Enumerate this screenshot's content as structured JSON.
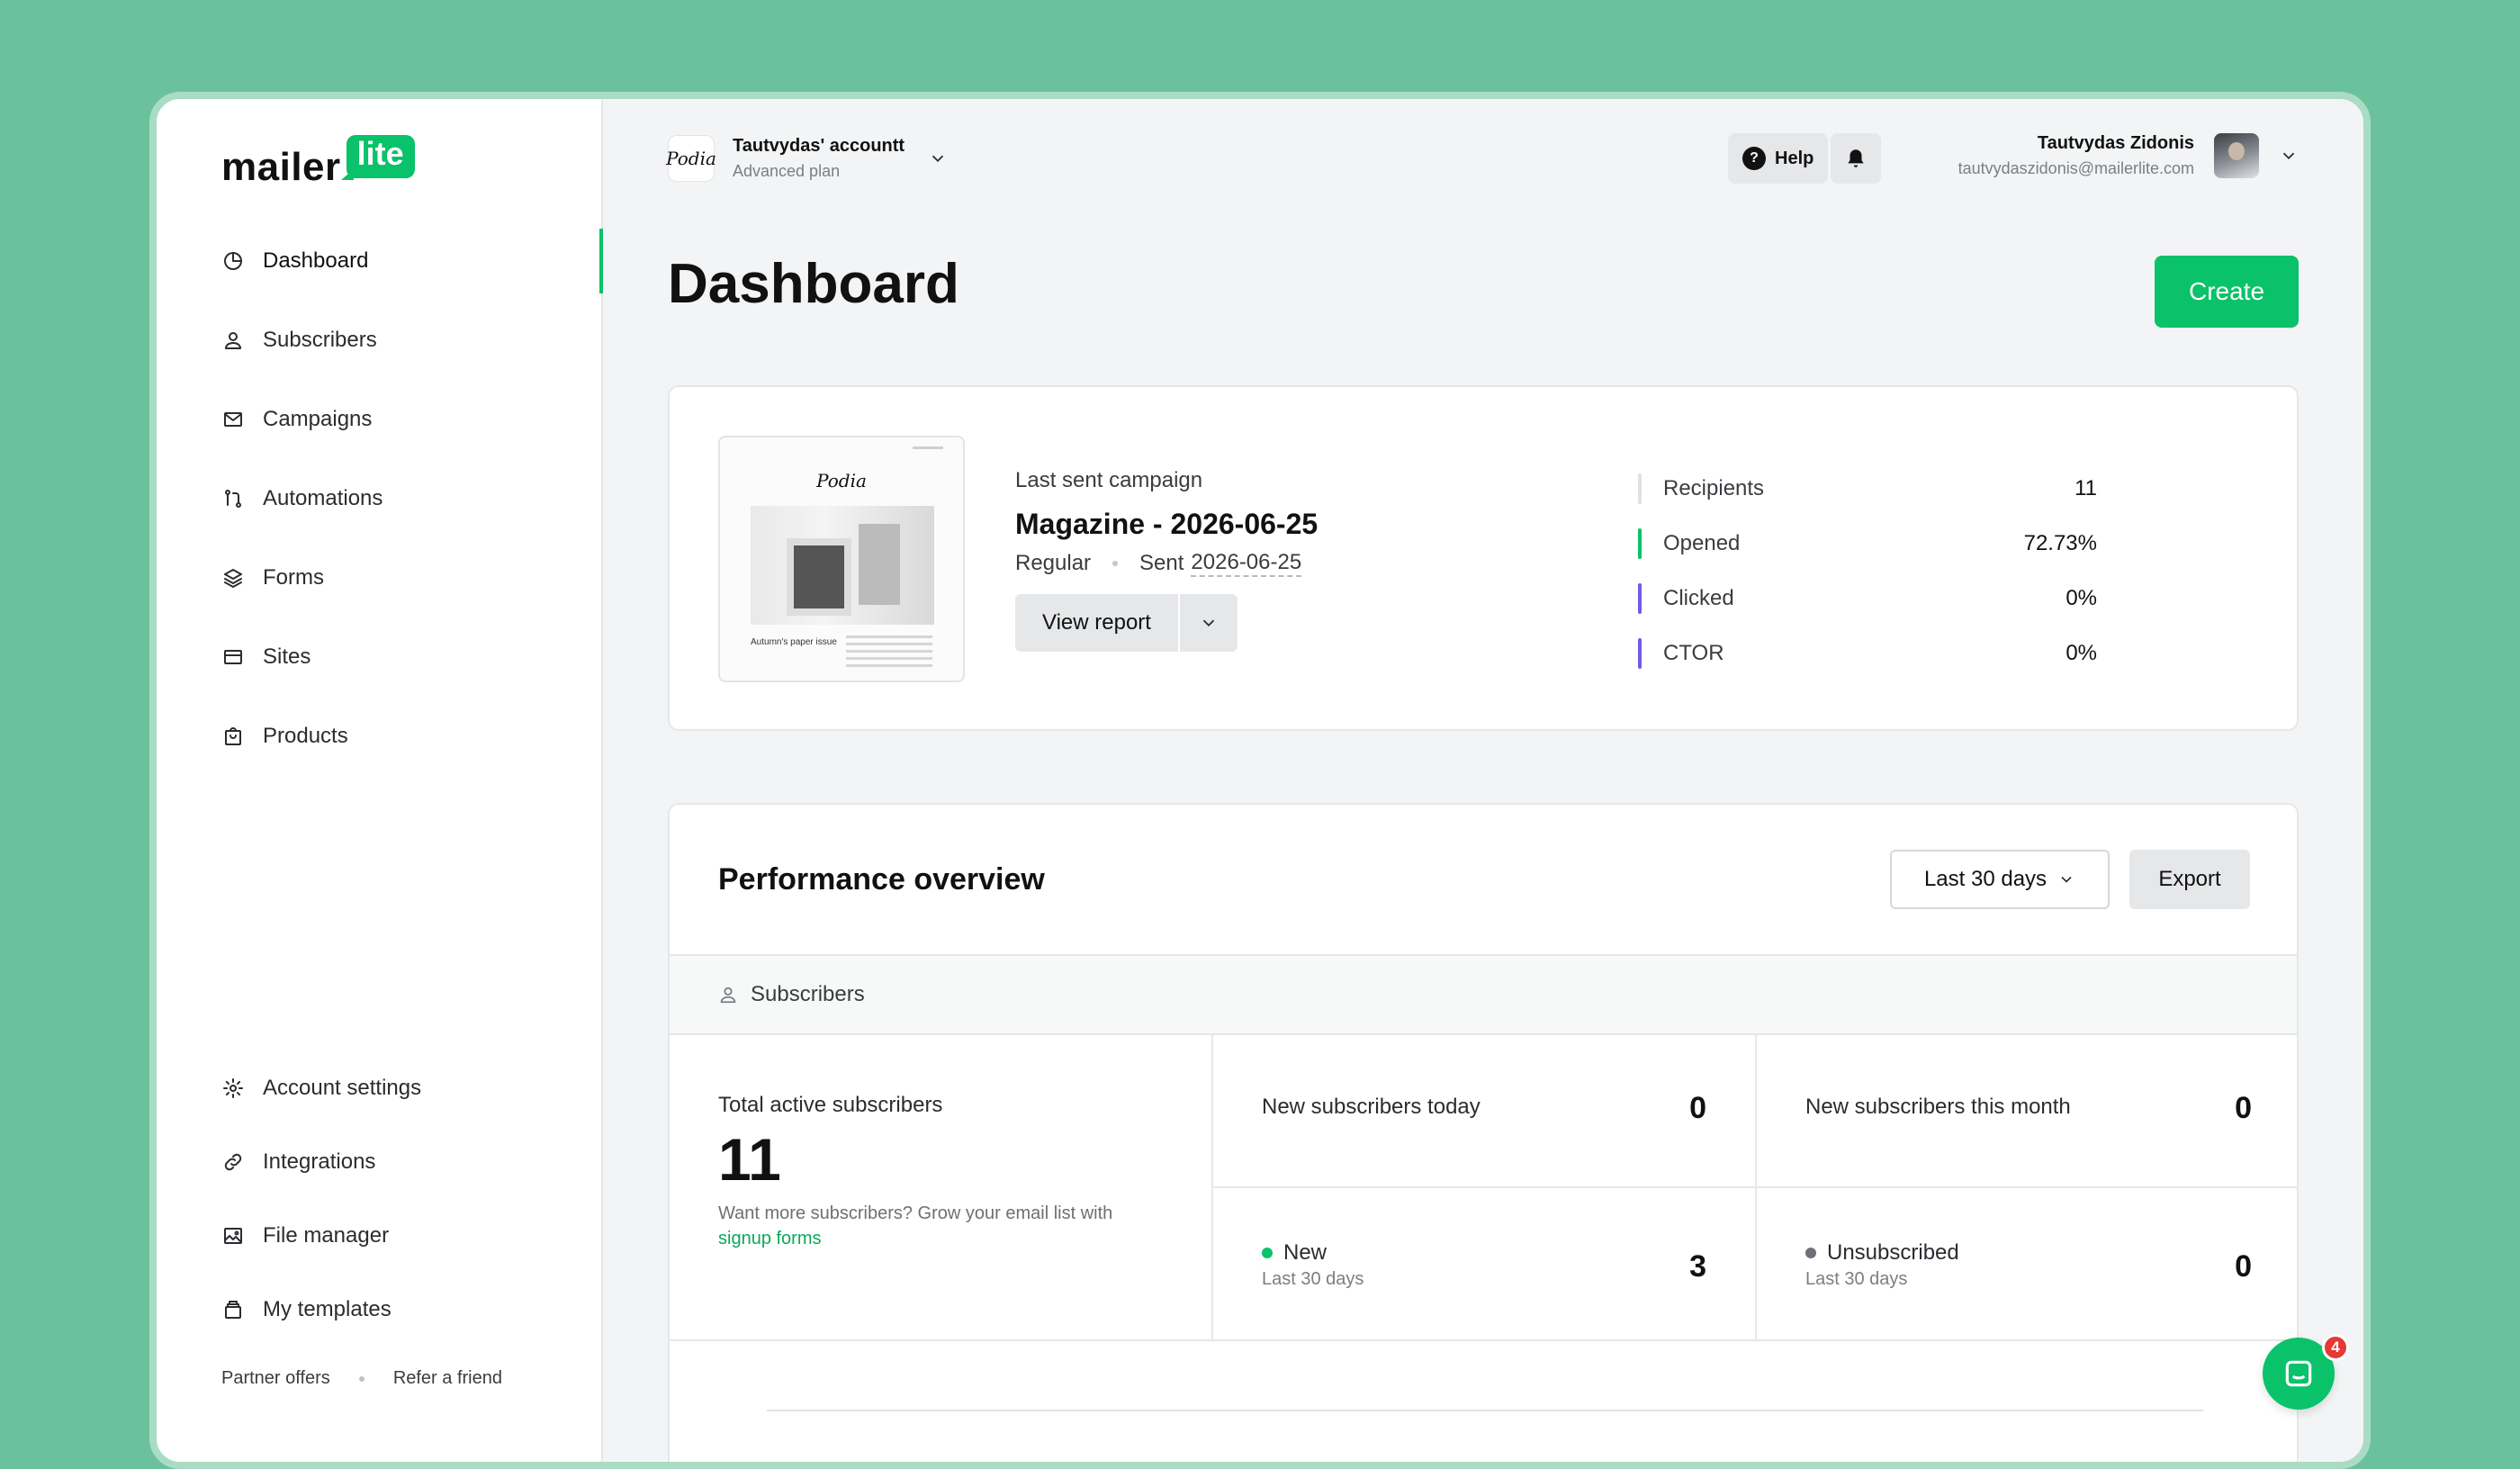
{
  "brand": {
    "word": "mailer",
    "badge": "lite",
    "accent": "#09c269"
  },
  "sidebar": {
    "items": [
      {
        "label": "Dashboard",
        "icon": "dashboard-icon",
        "active": true
      },
      {
        "label": "Subscribers",
        "icon": "user-icon"
      },
      {
        "label": "Campaigns",
        "icon": "mail-icon"
      },
      {
        "label": "Automations",
        "icon": "automation-icon"
      },
      {
        "label": "Forms",
        "icon": "layers-icon"
      },
      {
        "label": "Sites",
        "icon": "browser-icon"
      },
      {
        "label": "Products",
        "icon": "bag-icon"
      }
    ],
    "bottom_items": [
      {
        "label": "Account settings",
        "icon": "gear-icon"
      },
      {
        "label": "Integrations",
        "icon": "link-icon"
      },
      {
        "label": "File manager",
        "icon": "image-icon"
      },
      {
        "label": "My templates",
        "icon": "templates-icon"
      }
    ],
    "footer": {
      "partner": "Partner offers",
      "refer": "Refer a friend"
    }
  },
  "header": {
    "account_logo": "Podia",
    "account_name": "Tautvydas' accountt",
    "account_plan": "Advanced plan",
    "help_label": "Help",
    "user_name": "Tautvydas Zidonis",
    "user_email": "tautvydaszidonis@mailerlite.com"
  },
  "page": {
    "title": "Dashboard",
    "create_label": "Create"
  },
  "campaign": {
    "thumb_logo": "Podia",
    "thumb_caption": "Autumn's paper issue",
    "label": "Last sent campaign",
    "title": "Magazine - 2026-06-25",
    "type": "Regular",
    "sent_prefix": "Sent",
    "sent_date": "2026-06-25",
    "view_report": "View report",
    "stats": [
      {
        "label": "Recipients",
        "value": "11",
        "color": "#e0e1e3"
      },
      {
        "label": "Opened",
        "value": "72.73%",
        "color": "#09c269"
      },
      {
        "label": "Clicked",
        "value": "0%",
        "color": "#6c5ce7"
      },
      {
        "label": "CTOR",
        "value": "0%",
        "color": "#6c5ce7"
      }
    ]
  },
  "performance": {
    "title": "Performance overview",
    "range": "Last 30 days",
    "export": "Export",
    "section": "Subscribers",
    "total_label": "Total active subscribers",
    "total_value": "11",
    "help_text": "Want more subscribers? Grow your email list with",
    "help_link": "signup forms",
    "new_today_label": "New subscribers today",
    "new_today_value": "0",
    "new_month_label": "New subscribers this month",
    "new_month_value": "0",
    "new_label": "New",
    "new_sub": "Last 30 days",
    "new_value": "3",
    "new_color": "#09c269",
    "unsub_label": "Unsubscribed",
    "unsub_sub": "Last 30 days",
    "unsub_value": "0",
    "unsub_color": "#6d7076"
  },
  "chat": {
    "badge": "4"
  }
}
